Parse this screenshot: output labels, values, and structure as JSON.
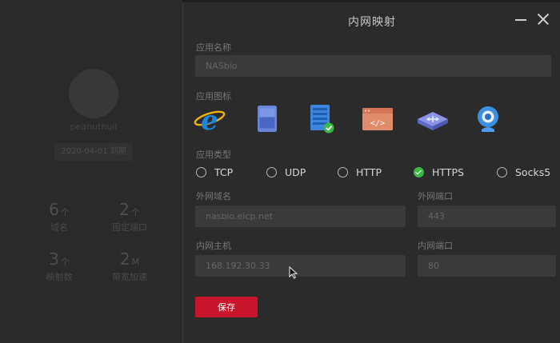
{
  "background": {
    "username": "peanuthull",
    "expire": "2020-04-01 到期",
    "stats": [
      {
        "num": "6",
        "unit": "个",
        "label": "域名"
      },
      {
        "num": "2",
        "unit": "个",
        "label": "固定端口"
      },
      {
        "num": "3",
        "unit": "个",
        "label": "映射数"
      },
      {
        "num": "2",
        "unit": "M",
        "label": "带宽加速"
      }
    ]
  },
  "modal": {
    "title": "内网映射",
    "app_name_label": "应用名称",
    "app_name_value": "NASbio",
    "app_icon_label": "应用图标",
    "app_icons": [
      "ie-browser-icon",
      "tablet-icon",
      "server-icon",
      "code-window-icon",
      "network-switch-icon",
      "webcam-icon"
    ],
    "app_type_label": "应用类型",
    "app_types": [
      "TCP",
      "UDP",
      "HTTP",
      "HTTPS",
      "Socks5"
    ],
    "app_type_selected": "HTTPS",
    "external_domain_label": "外网域名",
    "external_domain_value": "nasbio.eicp.net",
    "external_port_label": "外网端口",
    "external_port_value": "443",
    "internal_host_label": "内网主机",
    "internal_host_value": "168.192.30.33",
    "internal_port_label": "内网端口",
    "internal_port_value": "80",
    "save_label": "保存"
  },
  "colors": {
    "accent": "#c8152c",
    "check": "#3db847",
    "panel": "#2b2b2b",
    "input": "#3a3a3a"
  }
}
